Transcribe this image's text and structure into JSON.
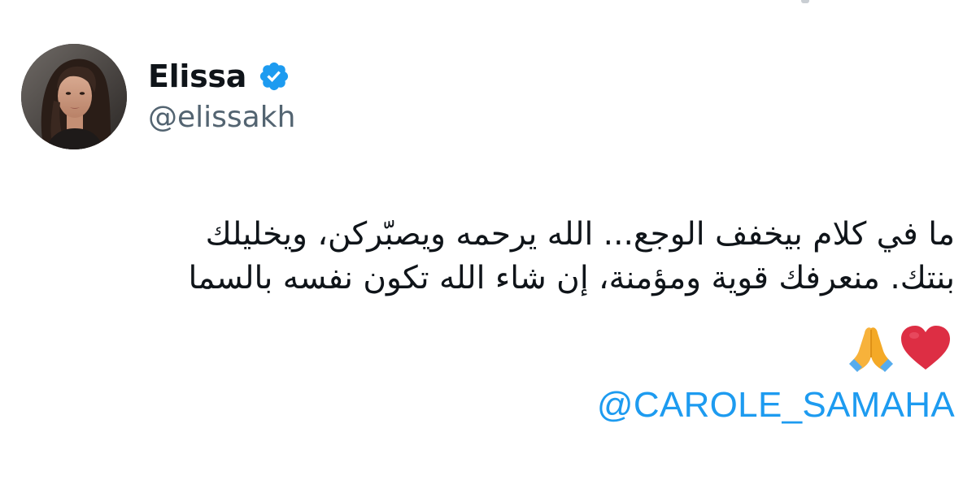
{
  "tweet": {
    "author": {
      "name": "Elissa",
      "handle": "@elissakh",
      "verified": true,
      "avatar": "profile-photo"
    },
    "text_lines": [
      "ما في كلام بيخفف الوجع... الله يرحمه ويصبّركن، ويخليلك",
      "بنتك. منعرفك قوية ومؤمنة، إن شاء الله تكون نفسه بالسما"
    ],
    "emojis": [
      "red-heart-icon",
      "folded-hands-icon"
    ],
    "mention": "@CAROLE_SAMAHA"
  },
  "colors": {
    "text": "#0f1419",
    "secondary_text": "#536471",
    "link": "#1d9bf0",
    "verified_badge": "#1d9bf0",
    "background": "#ffffff"
  }
}
